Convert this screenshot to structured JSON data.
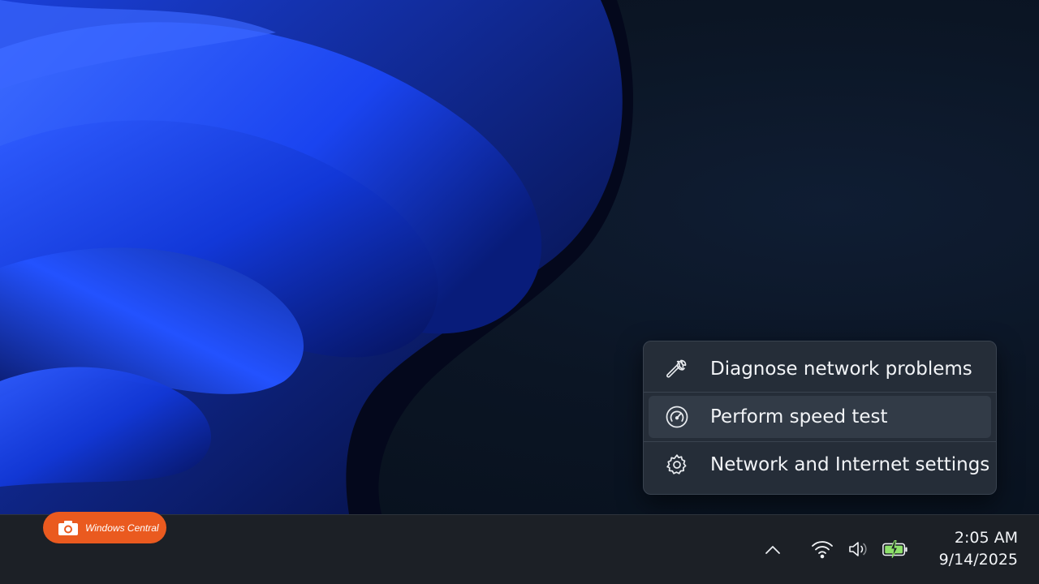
{
  "context_menu": {
    "items": [
      {
        "label": "Diagnose network problems",
        "icon": "wrench-icon"
      },
      {
        "label": "Perform speed test",
        "icon": "speedometer-icon"
      },
      {
        "label": "Network and Internet settings",
        "icon": "gear-icon"
      }
    ]
  },
  "watermark": {
    "text": "Windows Central",
    "color": "#ea5a1f"
  },
  "taskbar": {
    "tray_icons": [
      "chevron-up-icon",
      "wifi-icon",
      "volume-icon",
      "battery-charging-icon"
    ],
    "clock": {
      "time": "2:05 AM",
      "date": "9/14/2025"
    }
  },
  "colors": {
    "accent_blue": "#1e4bff",
    "taskbar": "#1c2026",
    "menu": "#252d38",
    "battery_green": "#8de06a"
  }
}
